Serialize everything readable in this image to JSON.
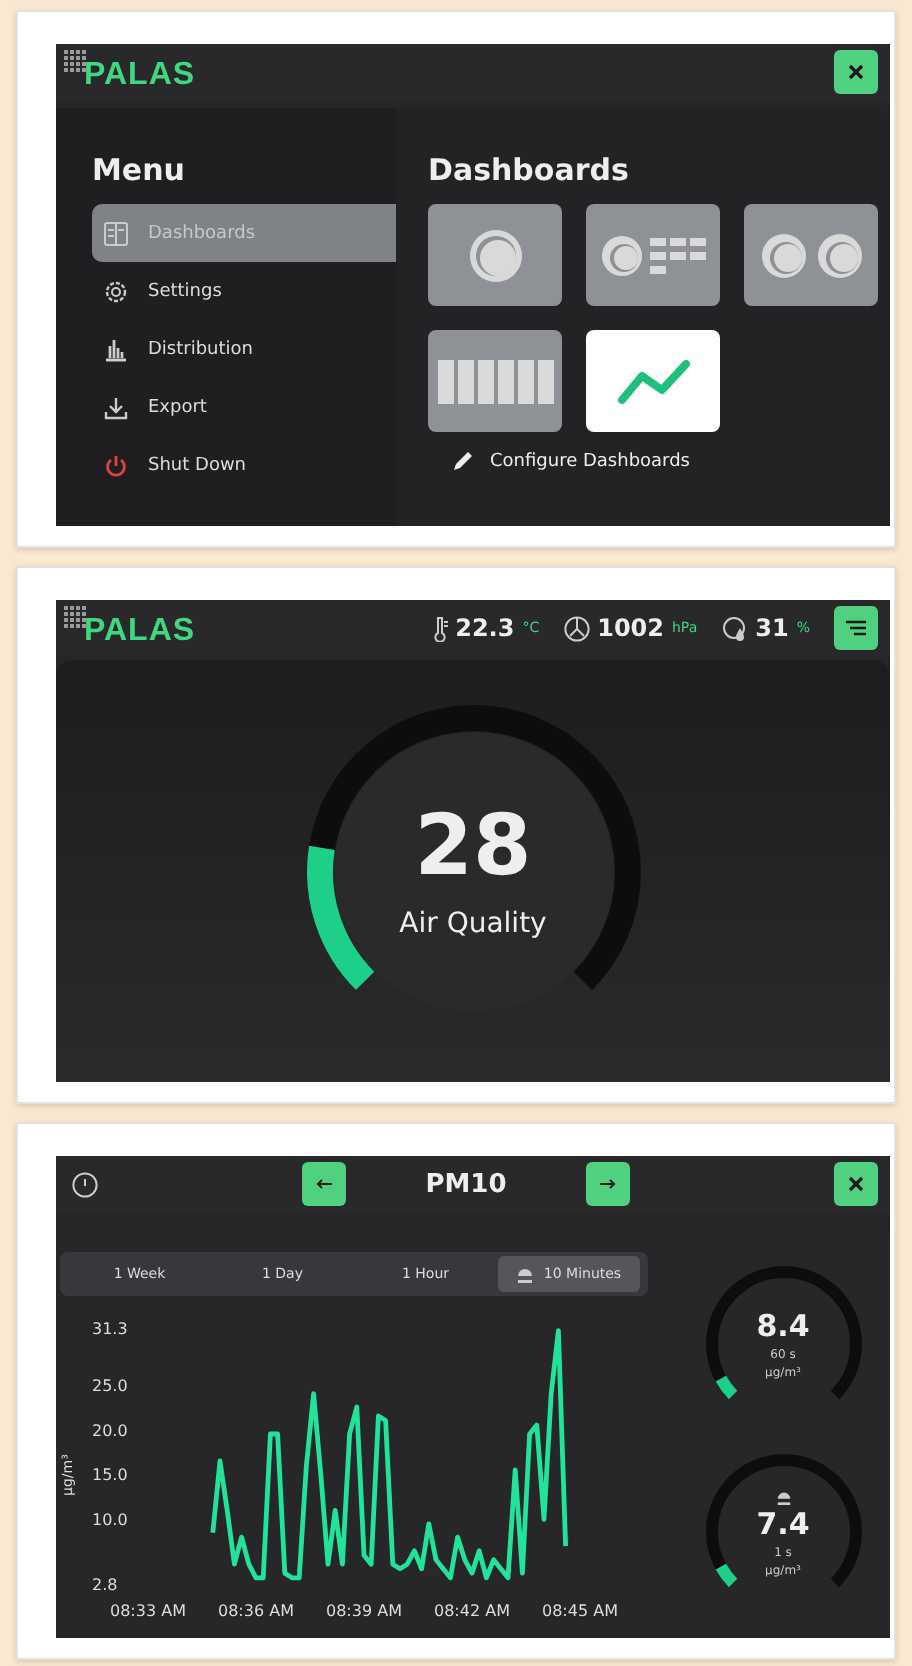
{
  "panels": [
    {
      "kind": "menu",
      "logo": "PALAS",
      "menu": {
        "title": "Menu",
        "items": [
          {
            "label": "Dashboards",
            "kind": "dashboards",
            "selected": true
          },
          {
            "label": "Settings",
            "kind": "settings",
            "selected": false
          },
          {
            "label": "Distribution",
            "kind": "distribution",
            "selected": false
          },
          {
            "label": "Export",
            "kind": "export",
            "selected": false
          },
          {
            "label": "Shut Down",
            "kind": "power",
            "selected": false
          }
        ]
      },
      "dashboards": {
        "title": "Dashboards",
        "tiles": [
          {
            "kind": "gauge",
            "selected": false
          },
          {
            "kind": "gauge-table",
            "selected": false
          },
          {
            "kind": "two-gauges",
            "selected": false
          },
          {
            "kind": "bars",
            "selected": false
          },
          {
            "kind": "chart",
            "selected": true
          }
        ],
        "configure": "Configure Dashboards"
      }
    },
    {
      "kind": "gauge",
      "logo": "PALAS",
      "readings": [
        {
          "kind": "temperature",
          "value": "22.3",
          "unit": "°C"
        },
        {
          "kind": "pressure",
          "value": "1002",
          "unit": "hPa"
        },
        {
          "kind": "humidity",
          "value": "31",
          "unit": "%"
        }
      ],
      "gauge": {
        "value": "28",
        "label": "Air Quality",
        "level": 0.2
      }
    },
    {
      "kind": "chart",
      "ranges": [
        {
          "label": "1 Week",
          "selected": false,
          "live": false
        },
        {
          "label": "1 Day",
          "selected": false,
          "live": false
        },
        {
          "label": "1 Hour",
          "selected": false,
          "live": false
        },
        {
          "label": "10 Minutes",
          "selected": true,
          "live": true
        }
      ],
      "chart_data": {
        "type": "line",
        "title": "PM10",
        "ylabel": "µg/m³",
        "ylim": [
          2.8,
          31.3
        ],
        "yticks": [
          2.8,
          {
            "value": 10,
            "label": "10.0"
          },
          {
            "value": 15,
            "label": "15.0"
          },
          {
            "value": 20,
            "label": "20.0"
          },
          {
            "value": 25,
            "label": "25.0"
          },
          31.3
        ],
        "categories": [
          "08:33 AM",
          null,
          null,
          null,
          null,
          null,
          null,
          null,
          null,
          null,
          null,
          null,
          null,
          null,
          null,
          "08:36 AM",
          null,
          null,
          null,
          null,
          null,
          null,
          null,
          null,
          null,
          null,
          null,
          null,
          null,
          null,
          "08:39 AM",
          null,
          null,
          null,
          null,
          null,
          null,
          null,
          null,
          null,
          null,
          null,
          null,
          null,
          null,
          "08:42 AM",
          null,
          null,
          null,
          null,
          null,
          null,
          null,
          null,
          null,
          null,
          null,
          null,
          null,
          null,
          "08:45 AM"
        ],
        "values": [
          null,
          null,
          null,
          null,
          null,
          null,
          null,
          null,
          null,
          8.5,
          16.5,
          11,
          5,
          8,
          5,
          3.5,
          3.5,
          19.5,
          19.5,
          4,
          3.5,
          3.5,
          16,
          24,
          15,
          5,
          11,
          5,
          19.5,
          22.5,
          6,
          5,
          21.5,
          21,
          5,
          4.5,
          5,
          6.5,
          4.5,
          9.5,
          5.5,
          4.5,
          3.5,
          8,
          5.5,
          4,
          6.5,
          3.5,
          5.5,
          4.5,
          3.5,
          15.5,
          4,
          19.5,
          20.5,
          10,
          24,
          31,
          7,
          null,
          null
        ]
      },
      "gauges": [
        {
          "value": "8.4",
          "period": "60 s",
          "unit": "µg/m³",
          "level": 0.06,
          "live": false
        },
        {
          "value": "7.4",
          "period": "1 s",
          "unit": "µg/m³",
          "level": 0.06,
          "live": true
        }
      ]
    }
  ]
}
